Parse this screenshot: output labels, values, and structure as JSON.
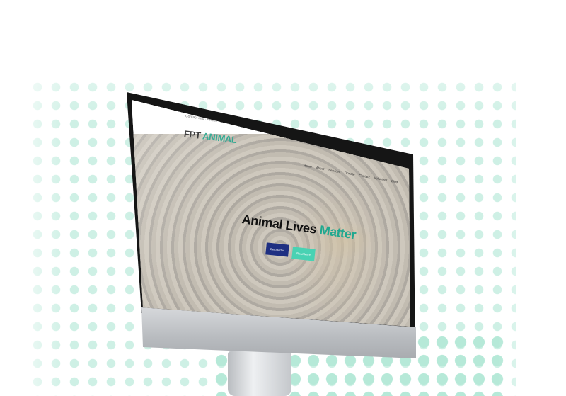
{
  "site": {
    "contact_text": "Contact info · Phone · Email",
    "brand_part1": "FPT",
    "brand_part2": "ANIMAL",
    "nav": [
      "Home",
      "About",
      "Services",
      "Donate",
      "Contact",
      "Volunteer",
      "Blog"
    ],
    "hero": {
      "headline_part1": "Animal Lives",
      "headline_part2": "Matter",
      "primary_button": "Get Started",
      "secondary_button": "Read More"
    }
  },
  "colors": {
    "accent": "#1fa88f",
    "primary_button": "#1e2f82",
    "secondary_button": "#49d2b3",
    "dots": "#c9eee2"
  }
}
